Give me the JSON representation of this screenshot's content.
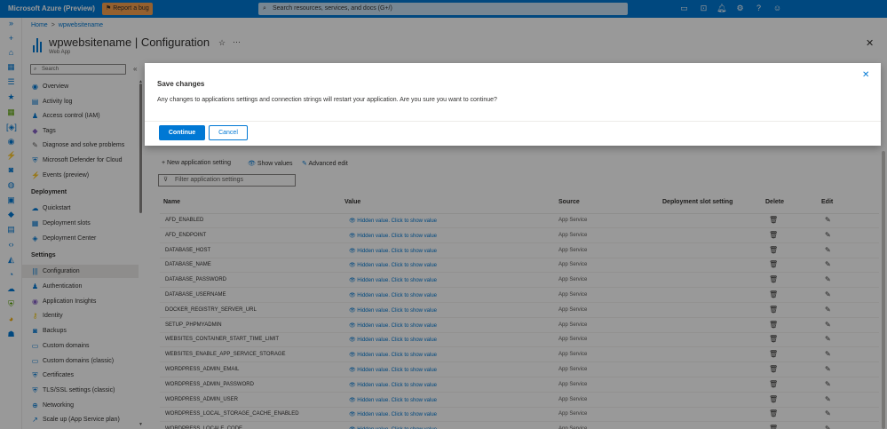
{
  "topbar": {
    "brand": "Microsoft Azure (Preview)",
    "bug": "Report a bug",
    "search_placeholder": "Search resources, services, and docs (G+/)"
  },
  "breadcrumb": {
    "home": "Home",
    "resource": "wpwebsitename"
  },
  "page": {
    "title": "wpwebsitename | Configuration",
    "subtitle": "Web App"
  },
  "sidebar": {
    "search_placeholder": "Search",
    "items": [
      {
        "label": "Overview",
        "icon": "globe-icon"
      },
      {
        "label": "Activity log",
        "icon": "log-icon"
      },
      {
        "label": "Access control (IAM)",
        "icon": "people-icon"
      },
      {
        "label": "Tags",
        "icon": "tag-icon"
      },
      {
        "label": "Diagnose and solve problems",
        "icon": "wrench-icon"
      },
      {
        "label": "Microsoft Defender for Cloud",
        "icon": "shield-icon"
      },
      {
        "label": "Events (preview)",
        "icon": "bolt-icon"
      }
    ],
    "deployment_header": "Deployment",
    "deployment": [
      {
        "label": "Quickstart",
        "icon": "cloud-icon"
      },
      {
        "label": "Deployment slots",
        "icon": "slots-icon"
      },
      {
        "label": "Deployment Center",
        "icon": "cube-icon"
      }
    ],
    "settings_header": "Settings",
    "settings": [
      {
        "label": "Configuration",
        "icon": "config-icon"
      },
      {
        "label": "Authentication",
        "icon": "people-icon"
      },
      {
        "label": "Application Insights",
        "icon": "bulb-icon"
      },
      {
        "label": "Identity",
        "icon": "key-icon"
      },
      {
        "label": "Backups",
        "icon": "backup-icon"
      },
      {
        "label": "Custom domains",
        "icon": "domain-icon"
      },
      {
        "label": "Custom domains (classic)",
        "icon": "domain-icon"
      },
      {
        "label": "Certificates",
        "icon": "certificate-icon"
      },
      {
        "label": "TLS/SSL settings (classic)",
        "icon": "lock-icon"
      },
      {
        "label": "Networking",
        "icon": "network-icon"
      },
      {
        "label": "Scale up (App Service plan)",
        "icon": "scale-icon"
      }
    ]
  },
  "toolbar": {
    "new_setting": "New application setting",
    "show_values": "Show values",
    "advanced_edit": "Advanced edit",
    "filter_placeholder": "Filter application settings"
  },
  "table": {
    "headers": {
      "name": "Name",
      "value": "Value",
      "source": "Source",
      "slot": "Deployment slot setting",
      "delete": "Delete",
      "edit": "Edit"
    },
    "hidden_text": "Hidden value. Click to show value",
    "rows": [
      {
        "name": "AFD_ENABLED",
        "source": "App Service"
      },
      {
        "name": "AFD_ENDPOINT",
        "source": "App Service"
      },
      {
        "name": "DATABASE_HOST",
        "source": "App Service"
      },
      {
        "name": "DATABASE_NAME",
        "source": "App Service"
      },
      {
        "name": "DATABASE_PASSWORD",
        "source": "App Service"
      },
      {
        "name": "DATABASE_USERNAME",
        "source": "App Service"
      },
      {
        "name": "DOCKER_REGISTRY_SERVER_URL",
        "source": "App Service"
      },
      {
        "name": "SETUP_PHPMYADMIN",
        "source": "App Service"
      },
      {
        "name": "WEBSITES_CONTAINER_START_TIME_LIMIT",
        "source": "App Service"
      },
      {
        "name": "WEBSITES_ENABLE_APP_SERVICE_STORAGE",
        "source": "App Service"
      },
      {
        "name": "WORDPRESS_ADMIN_EMAIL",
        "source": "App Service"
      },
      {
        "name": "WORDPRESS_ADMIN_PASSWORD",
        "source": "App Service"
      },
      {
        "name": "WORDPRESS_ADMIN_USER",
        "source": "App Service"
      },
      {
        "name": "WORDPRESS_LOCAL_STORAGE_CACHE_ENABLED",
        "source": "App Service"
      },
      {
        "name": "WORDPRESS_LOCALE_CODE",
        "source": "App Service"
      }
    ]
  },
  "dialog": {
    "title": "Save changes",
    "message": "Any changes to applications settings and connection strings will restart your application. Are you sure you want to continue?",
    "continue": "Continue",
    "cancel": "Cancel"
  }
}
